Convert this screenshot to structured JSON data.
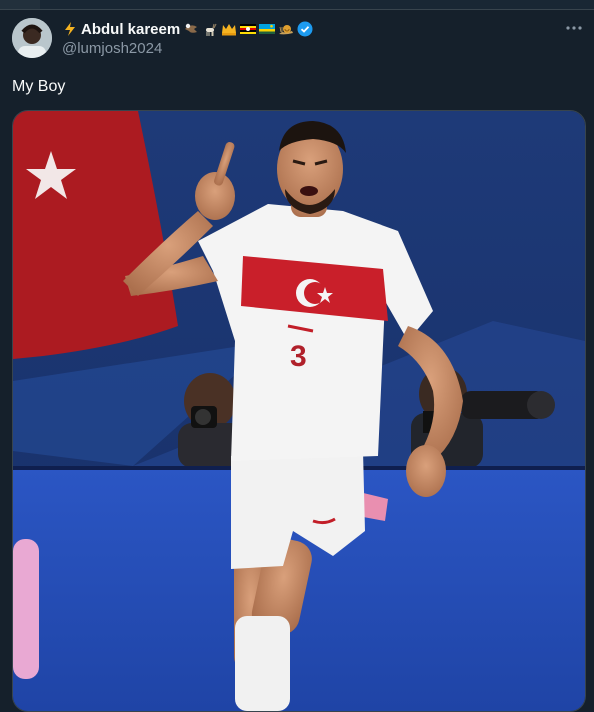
{
  "post": {
    "display_name": "Abdul kareem",
    "handle": "@lumjosh2024",
    "text": "My Boy",
    "verified": true,
    "name_emojis": [
      "lightning-icon",
      "eagle-icon",
      "goat-icon",
      "crown-icon",
      "uganda-flag-icon",
      "rwanda-flag-icon",
      "snail-icon"
    ]
  },
  "media": {
    "subject": "footballer in white and red kit celebrating",
    "jersey_number": "3"
  },
  "colors": {
    "background": "#15202b",
    "text": "#f7f9f9",
    "secondary_text": "#8b98a5",
    "verified": "#1d9bf0",
    "border": "#38444d"
  }
}
